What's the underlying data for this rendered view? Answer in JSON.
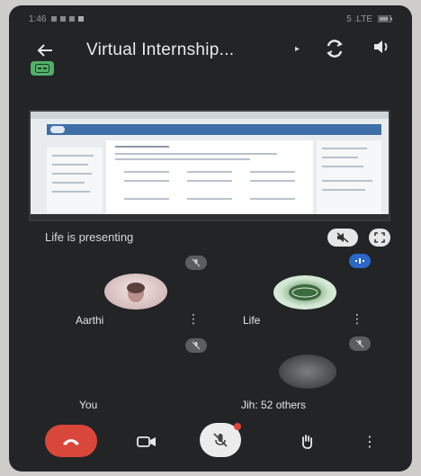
{
  "colors": {
    "background": "#222426",
    "end_call": "#d9473a",
    "caption_badge": "#52b06a",
    "active_speaker": "#2b68c7"
  },
  "status_bar": {
    "time": "1:46",
    "network": "5 .LTE"
  },
  "header": {
    "title": "Virtual Internship...",
    "back_icon": "arrow-left-icon",
    "switch_camera_icon": "switch-camera-icon",
    "speaker_icon": "speaker-icon"
  },
  "presentation": {
    "label": "Life is presenting"
  },
  "participants": [
    {
      "name": "Aarthi",
      "mic": "muted",
      "avatar": "photo"
    },
    {
      "name": "Life",
      "mic": "speaking",
      "avatar": "logo"
    },
    {
      "name": "You",
      "mic": "muted",
      "avatar": "none"
    },
    {
      "name": "Jih: 52 others",
      "mic": "muted",
      "avatar": "photo"
    }
  ],
  "controls": {
    "end_call_icon": "phone-hangup-icon",
    "camera_icon": "video-camera-icon",
    "mic_icon": "mic-off-icon",
    "raise_hand_icon": "hand-icon",
    "more_icon": "more-vert-icon"
  }
}
